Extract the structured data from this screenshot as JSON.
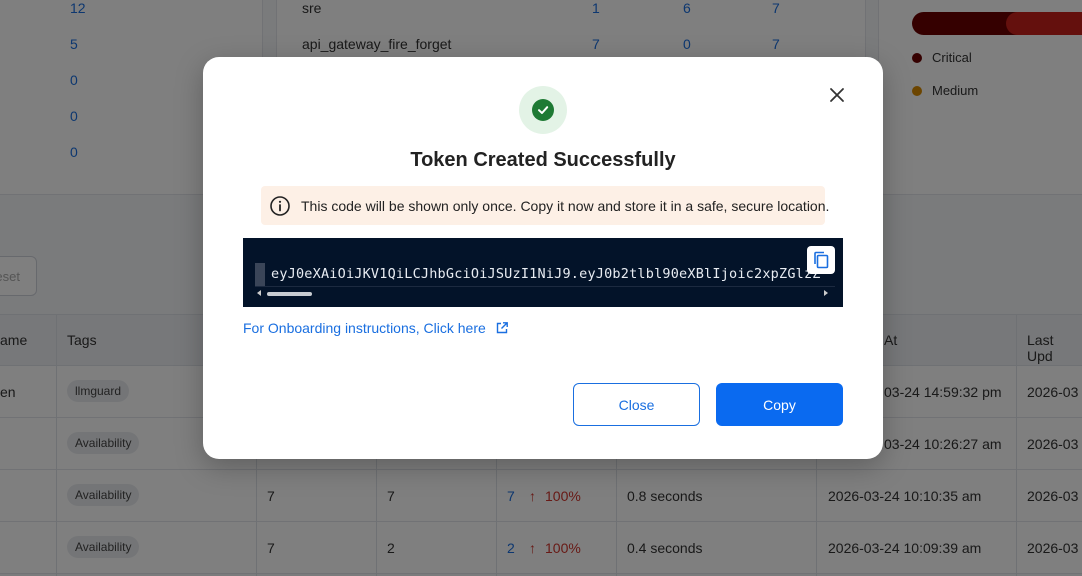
{
  "background": {
    "left_counts": [
      "12",
      "5",
      "0",
      "0",
      "0"
    ],
    "service_rows": [
      {
        "name": "sre",
        "a": "1",
        "b": "6",
        "c": "7"
      },
      {
        "name": "api_gateway_fire_forget",
        "a": "7",
        "b": "0",
        "c": "7"
      }
    ],
    "severity_legend": [
      {
        "label": "Critical",
        "color": "#6a0000"
      },
      {
        "label": "Medium",
        "color": "#d98a00"
      }
    ],
    "reset_label": "eset",
    "table": {
      "headers": [
        "ame",
        "Tags",
        "At",
        "Last Upd"
      ],
      "rows": [
        {
          "name": "en",
          "tag": "llmguard",
          "col1": "",
          "col2": "",
          "count": "",
          "pct": "",
          "latency": "",
          "created": "03-24 14:59:32 pm",
          "updated": "2026-03"
        },
        {
          "name": "",
          "tag": "Availability",
          "col1": "",
          "col2": "",
          "count": "",
          "pct": "",
          "latency": "",
          "created": "03-24 10:26:27 am",
          "updated": "2026-03"
        },
        {
          "name": "",
          "tag": "Availability",
          "col1": "7",
          "col2": "7",
          "count": "7",
          "pct": "100%",
          "latency": "0.8 seconds",
          "created": "2026-03-24 10:10:35 am",
          "updated": "2026-03"
        },
        {
          "name": "",
          "tag": "Availability",
          "col1": "7",
          "col2": "2",
          "count": "2",
          "pct": "100%",
          "latency": "0.4 seconds",
          "created": "2026-03-24 10:09:39 am",
          "updated": "2026-03"
        }
      ]
    }
  },
  "modal": {
    "title": "Token Created Successfully",
    "notice": "This code will be shown only once. Copy it now and store it in a safe, secure location.",
    "token": "eyJ0eXAiOiJKV1QiLCJhbGciOiJSUzI1NiJ9.eyJ0b2tlbl90eXBlIjoic2xpZGlzZ",
    "onboarding_link": "For Onboarding instructions, Click here",
    "close_label": "Close",
    "copy_label": "Copy",
    "icons": {
      "success": "check-circle-icon",
      "close": "close-icon",
      "info": "info-icon",
      "copy": "copy-icon",
      "external": "external-link-icon"
    },
    "colors": {
      "accent": "#0a6af0",
      "success": "#1e7a34",
      "notice_bg": "#fdf0e6",
      "code_bg": "#031329"
    }
  }
}
